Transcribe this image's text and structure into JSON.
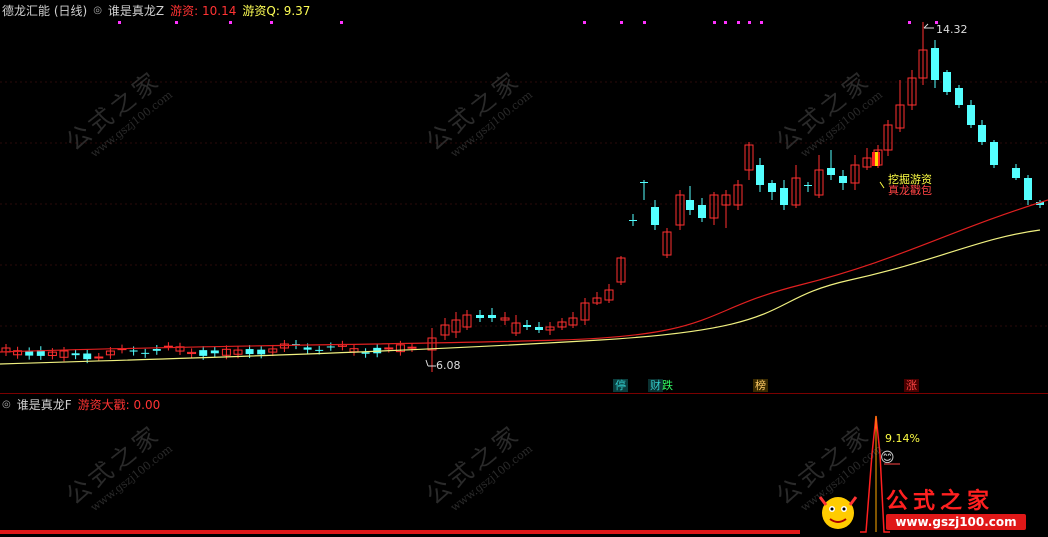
{
  "main_panel": {
    "title": "德龙汇能 (日线)",
    "indicator_name": "谁是真龙Z",
    "metric1_label": "游资:",
    "metric1_value": "10.14",
    "metric2_label": "游资Q:",
    "metric2_value": "9.37",
    "high_label": "14.32",
    "low_label": "6.08",
    "annotation_line1": "挖掘游资",
    "annotation_line2": "真龙戳包",
    "event_tags": [
      {
        "text": "停",
        "color": "#33cccc"
      },
      {
        "text": "财",
        "color": "#33cccc"
      },
      {
        "text": "跌",
        "color": "#33ff66"
      },
      {
        "text": "榜",
        "color": "#ffcc66"
      },
      {
        "text": "涨",
        "color": "#ff4444"
      }
    ]
  },
  "sub_panel": {
    "indicator_name": "谁是真龙F",
    "metric_label": "游资大戳:",
    "metric_value": "0.00",
    "peak_label": "9.14%"
  },
  "watermark": {
    "text": "公式之家",
    "url": "www.gszj100.com"
  },
  "brand": {
    "title": "公式之家",
    "url": "www.gszj100.com"
  },
  "colors": {
    "up": "#ff3030",
    "down": "#54ffff",
    "ma_red": "#e02020",
    "ma_yellow": "#f0f080",
    "marker": "#ff33ff"
  }
}
